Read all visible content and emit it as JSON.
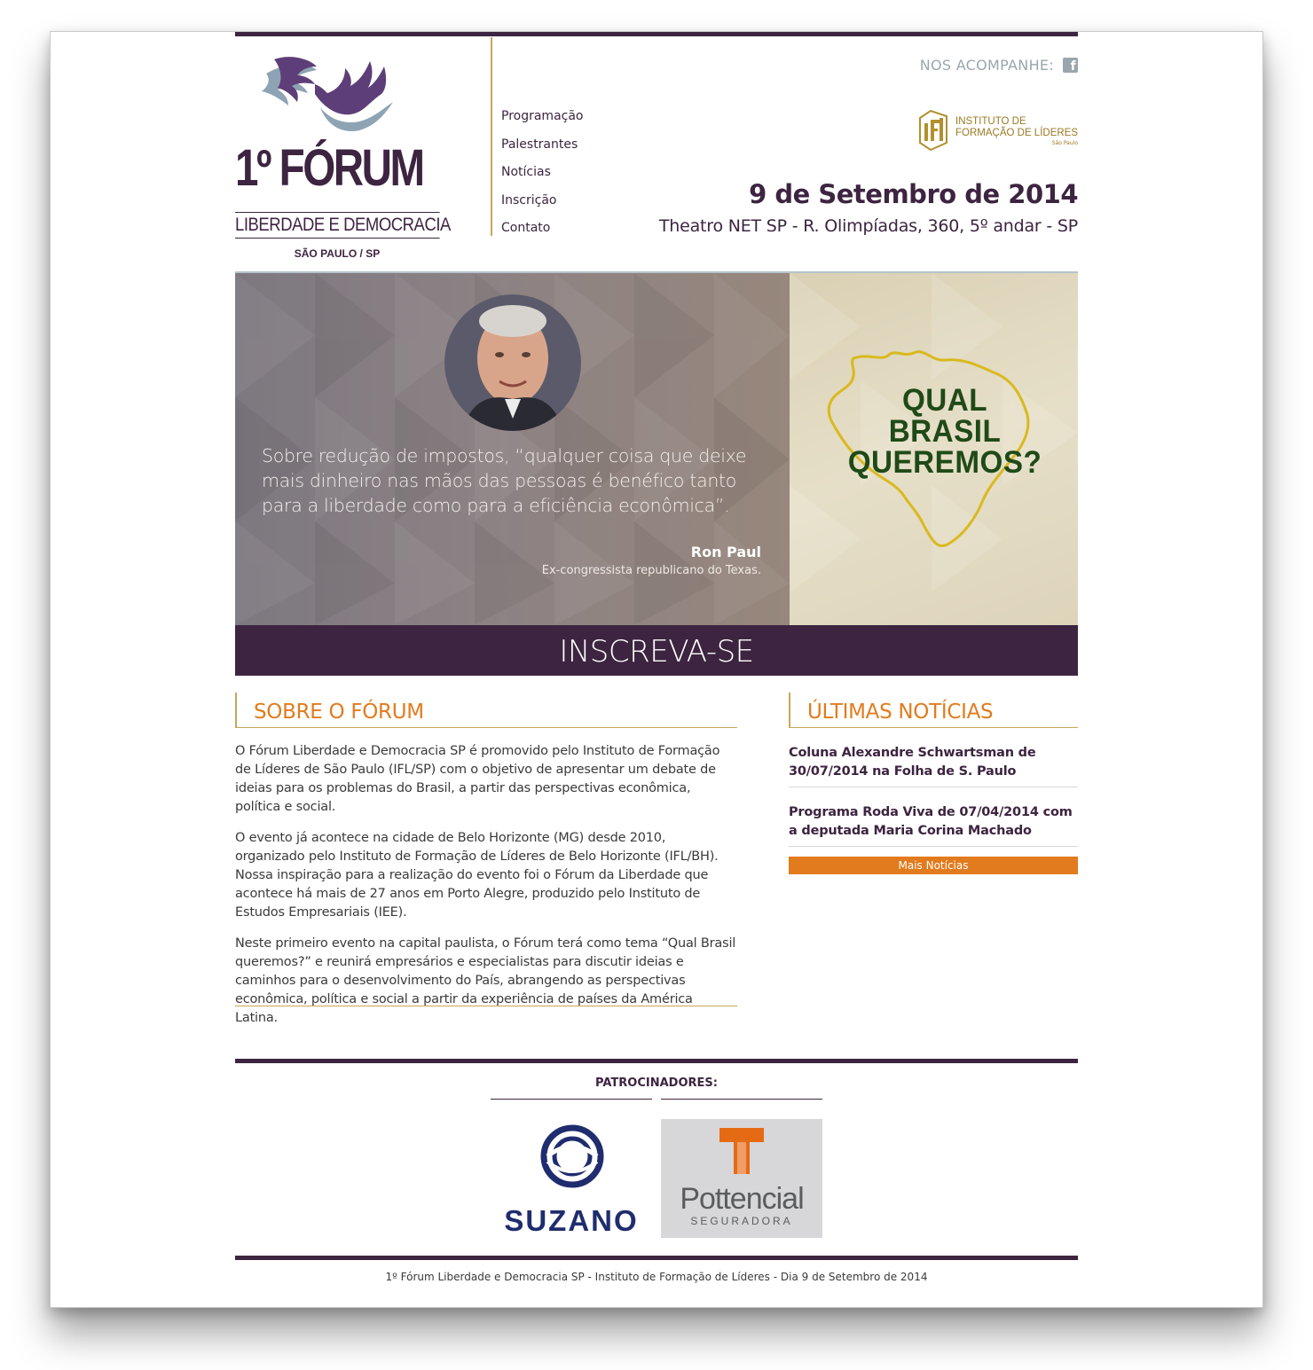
{
  "header": {
    "logo": {
      "title": "1º FÓRUM",
      "subtitle": "LIBERDADE E DEMOCRACIA",
      "city": "SÃO PAULO / SP"
    },
    "nav": [
      "Programação",
      "Palestrantes",
      "Notícias",
      "Inscrição",
      "Contato"
    ],
    "follow_label": "NOS ACOMPANHE:",
    "facebook_icon": "facebook-icon",
    "partner_logo": {
      "mark": "ifl",
      "line1": "INSTITUTO DE",
      "line2": "FORMAÇÃO DE LÍDERES",
      "line3": "São Paulo"
    },
    "event_date": "9 de Setembro de 2014",
    "venue": "Theatro NET SP - R. Olimpíadas, 360, 5º andar - SP"
  },
  "hero": {
    "quote": "Sobre redução de impostos, “qualquer coisa que deixe mais dinheiro nas mãos das pessoas é benéfico tanto para a liberdade como para a eficiência econômica”.",
    "author": "Ron Paul",
    "author_role": "Ex-congressista republicano do Texas.",
    "theme_lines": [
      "QUAL",
      "BRASIL",
      "QUEREMOS?"
    ],
    "cta": "INSCREVA-SE"
  },
  "about": {
    "heading": "SOBRE O FÓRUM",
    "paragraphs": [
      "O Fórum Liberdade e Democracia SP é promovido pelo Instituto de Formação de Líderes de São Paulo (IFL/SP) com o objetivo de apresentar um debate de ideias para os problemas do Brasil, a partir das perspectivas econômica, política e social.",
      "O evento já acontece na cidade de Belo Horizonte (MG) desde 2010, organizado pelo Instituto de Formação de Líderes de Belo Horizonte (IFL/BH). Nossa inspiração para a realização do evento foi o Fórum da Liberdade que acontece há mais de 27 anos em Porto Alegre, produzido pelo Instituto de Estudos Empresariais (IEE).",
      "Neste primeiro evento na capital paulista, o Fórum terá como tema “Qual Brasil queremos?” e reunirá empresários e especialistas para discutir ideias e caminhos para o desenvolvimento do País, abrangendo as perspectivas econômica, política e social a partir da experiência de países da América Latina."
    ]
  },
  "news": {
    "heading": "ÚLTIMAS NOTÍCIAS",
    "items": [
      "Coluna Alexandre Schwartsman de 30/07/2014 na Folha de S. Paulo",
      "Programa Roda Viva de 07/04/2014 com a deputada Maria Corina Machado"
    ],
    "more_label": "Mais Notícias"
  },
  "sponsors": {
    "title": "PATROCINADORES:",
    "items": [
      {
        "name": "SUZANO",
        "tagline": ""
      },
      {
        "name": "Pottencial",
        "tagline": "SEGURADORA"
      }
    ]
  },
  "footer": {
    "text": "1º Fórum Liberdade e Democracia SP - Instituto de Formação de Líderes - Dia 9 de Setembro de 2014"
  },
  "colors": {
    "brand_purple": "#3d2440",
    "accent_orange": "#e27b1d",
    "gold": "#c9a65a",
    "theme_green": "#1f4a18"
  }
}
